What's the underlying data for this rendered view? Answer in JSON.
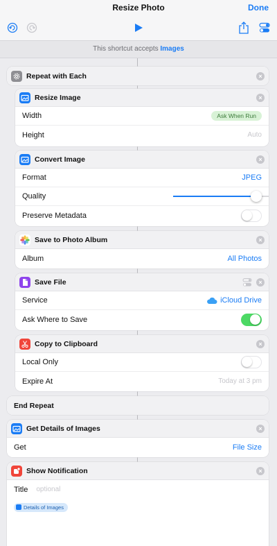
{
  "nav": {
    "title": "Resize Photo",
    "done": "Done"
  },
  "subheader": {
    "prefix": "This shortcut accepts ",
    "accent": "Images"
  },
  "repeat": {
    "title": "Repeat with Each",
    "end": "End Repeat"
  },
  "resize": {
    "title": "Resize Image",
    "width_label": "Width",
    "width_value": "Ask When Run",
    "height_label": "Height",
    "height_value": "Auto"
  },
  "convert": {
    "title": "Convert Image",
    "format_label": "Format",
    "format_value": "JPEG",
    "quality_label": "Quality",
    "quality_fraction": 0.8,
    "metadata_label": "Preserve Metadata"
  },
  "album": {
    "title": "Save to Photo Album",
    "album_label": "Album",
    "album_value": "All Photos"
  },
  "savefile": {
    "title": "Save File",
    "service_label": "Service",
    "service_value": "iCloud Drive",
    "ask_label": "Ask Where to Save"
  },
  "clipboard": {
    "title": "Copy to Clipboard",
    "local_label": "Local Only",
    "expire_label": "Expire At",
    "expire_value": "Today at 3 pm"
  },
  "details": {
    "title": "Get Details of Images",
    "get_label": "Get",
    "get_value": "File Size"
  },
  "notify": {
    "title": "Show Notification",
    "title_label": "Title",
    "title_placeholder": "optional",
    "chip": "Details of Images"
  },
  "colors": {
    "accent": "#1a7cf5",
    "toggle_on": "#4cd964"
  }
}
